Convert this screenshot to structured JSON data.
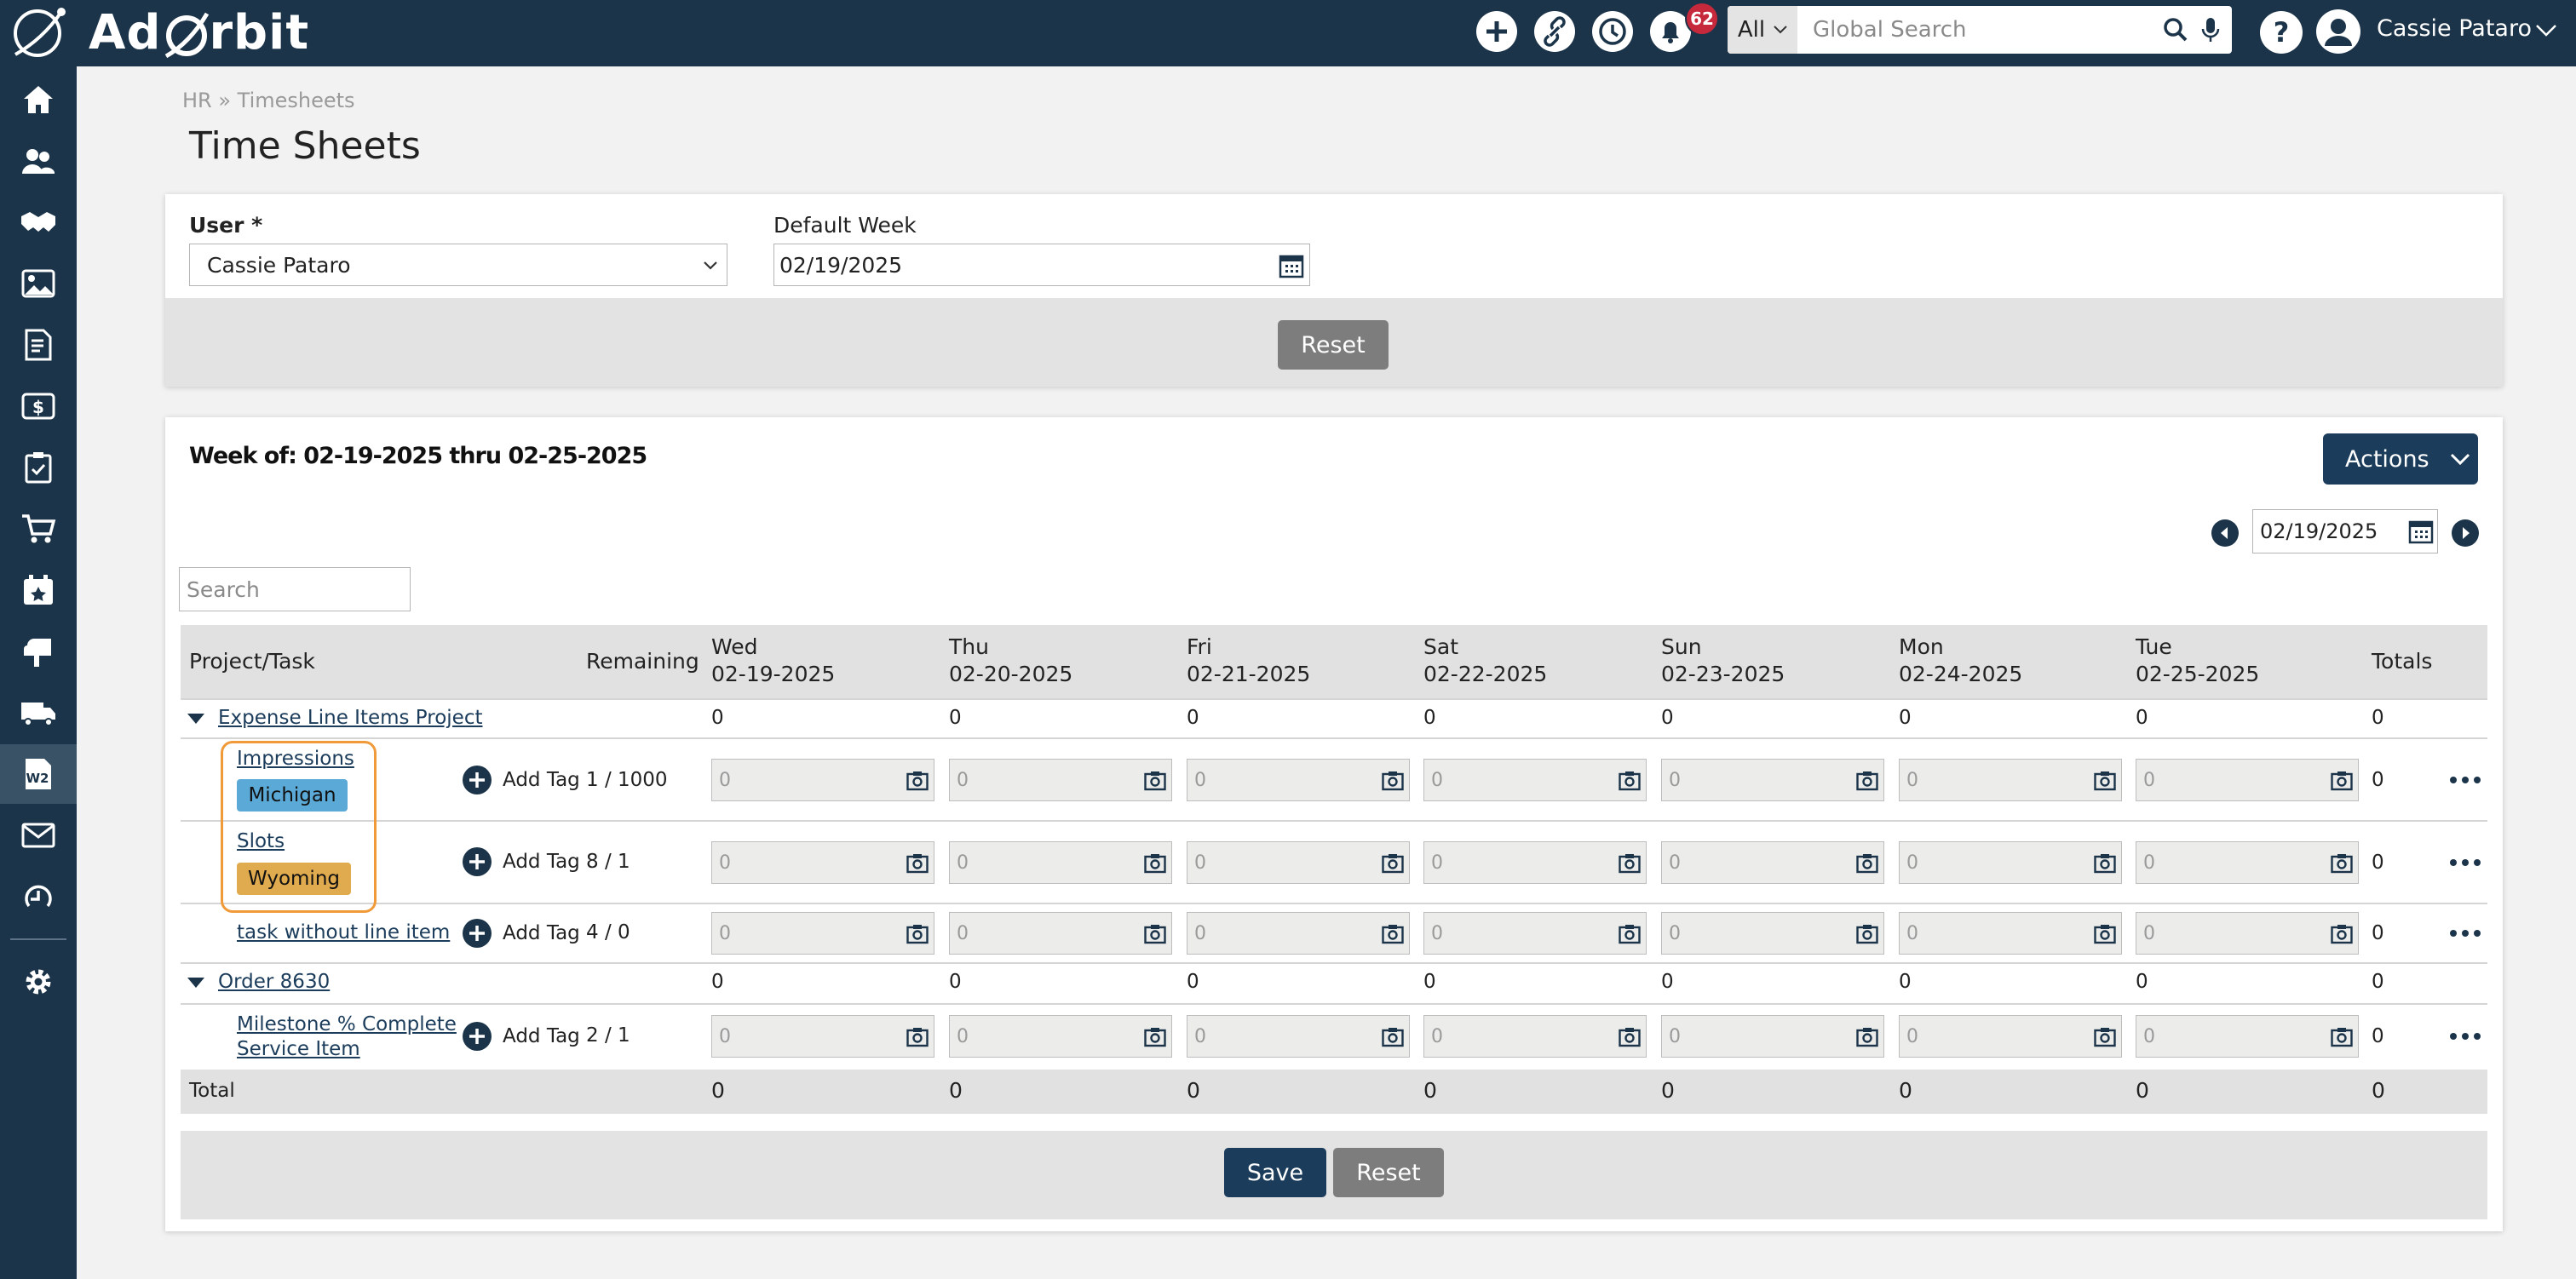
{
  "app": {
    "brand": "AdOrbit",
    "brand_left": "Ad",
    "brand_right": "rbit"
  },
  "topbar": {
    "notifications_count": "62",
    "search_scope": "All",
    "search_placeholder": "Global Search",
    "user_name": "Cassie Pataro"
  },
  "sidebar": {
    "items": [
      "home-icon",
      "contacts-icon",
      "handshake-icon",
      "images-icon",
      "invoice-icon",
      "dollar-exchange-icon",
      "clipboard-check-icon",
      "cart-icon",
      "calendar-star-icon",
      "mailbox-icon",
      "truck-icon",
      "w2-form-icon",
      "envelope-icon",
      "circle-arrow-icon",
      "settings-icon"
    ],
    "active": "w2-form-icon"
  },
  "breadcrumb": "HR » Timesheets",
  "page_title": "Time Sheets",
  "filters": {
    "user_label": "User *",
    "user_value": "Cassie Pataro",
    "week_label": "Default Week",
    "week_value": "02/19/2025",
    "reset_label": "Reset"
  },
  "week": {
    "title": "Week of: 02-19-2025 thru 02-25-2025",
    "actions_label": "Actions",
    "nav_date": "02/19/2025",
    "search_placeholder": "Search"
  },
  "table": {
    "col_project": "Project/Task",
    "col_remaining": "Remaining",
    "col_totals": "Totals",
    "days": [
      {
        "name": "Wed",
        "date": "02-19-2025"
      },
      {
        "name": "Thu",
        "date": "02-20-2025"
      },
      {
        "name": "Fri",
        "date": "02-21-2025"
      },
      {
        "name": "Sat",
        "date": "02-22-2025"
      },
      {
        "name": "Sun",
        "date": "02-23-2025"
      },
      {
        "name": "Mon",
        "date": "02-24-2025"
      },
      {
        "name": "Tue",
        "date": "02-25-2025"
      }
    ],
    "projects": [
      {
        "name": "Expense Line Items Project",
        "day_totals": [
          "0",
          "0",
          "0",
          "0",
          "0",
          "0",
          "0"
        ],
        "total": "0",
        "tasks": [
          {
            "name": "Impressions",
            "tag": "Michigan",
            "tag_color": "#5aa9d6",
            "remaining": "1 / 1000",
            "hours": [
              "0",
              "0",
              "0",
              "0",
              "0",
              "0",
              "0"
            ],
            "total": "0"
          },
          {
            "name": "Slots",
            "tag": "Wyoming",
            "tag_color": "#e0aa4e",
            "remaining": "8 / 1",
            "hours": [
              "0",
              "0",
              "0",
              "0",
              "0",
              "0",
              "0"
            ],
            "total": "0"
          },
          {
            "name": "task without line item",
            "remaining": "4 / 0",
            "hours": [
              "0",
              "0",
              "0",
              "0",
              "0",
              "0",
              "0"
            ],
            "total": "0"
          }
        ]
      },
      {
        "name": "Order 8630",
        "day_totals": [
          "0",
          "0",
          "0",
          "0",
          "0",
          "0",
          "0"
        ],
        "total": "0",
        "tasks": [
          {
            "name_line1": "Milestone % Complete",
            "name_line2": "Service Item",
            "remaining": "2 / 1",
            "hours": [
              "0",
              "0",
              "0",
              "0",
              "0",
              "0",
              "0"
            ],
            "total": "0"
          }
        ]
      }
    ],
    "add_tag_label": "Add Tag",
    "total_label": "Total",
    "grand_totals": [
      "0",
      "0",
      "0",
      "0",
      "0",
      "0",
      "0"
    ],
    "grand_total": "0"
  },
  "footer": {
    "save_label": "Save",
    "reset_label": "Reset"
  },
  "colors": {
    "navy": "#1b3449",
    "button_navy": "#1b3c5b",
    "highlight": "#f09a3a",
    "badge": "#c6283c"
  }
}
